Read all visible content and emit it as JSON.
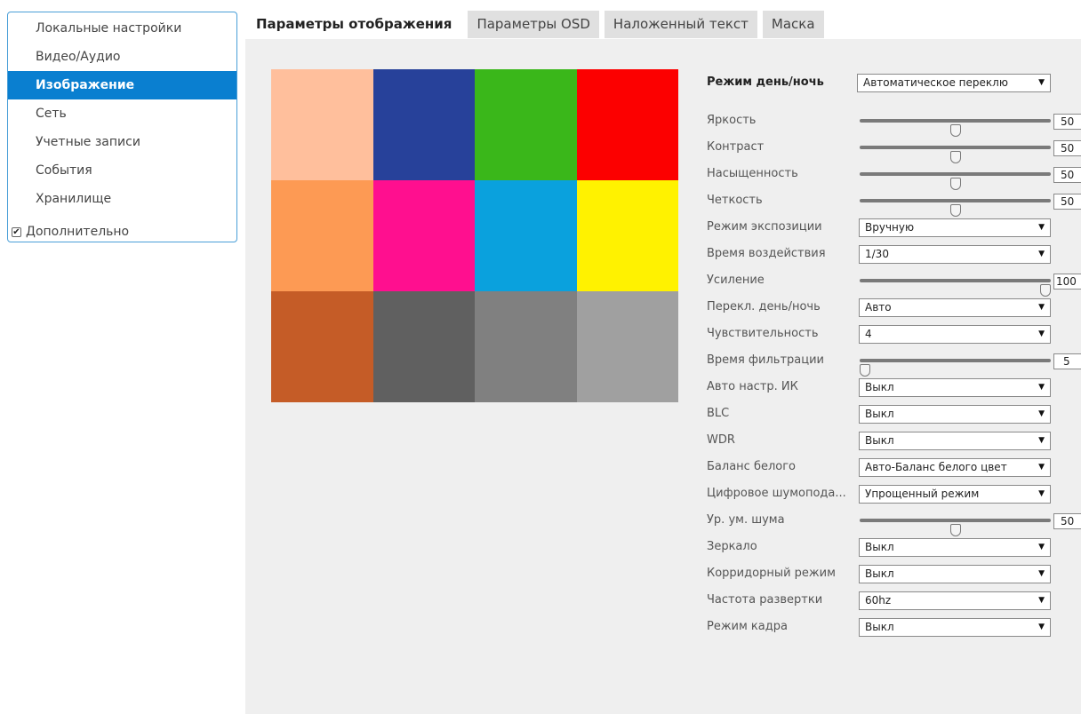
{
  "sidebar": {
    "items": [
      {
        "label": "Локальные настройки",
        "active": false
      },
      {
        "label": "Видео/Аудио",
        "active": false
      },
      {
        "label": "Изображение",
        "active": true
      },
      {
        "label": "Сеть",
        "active": false
      },
      {
        "label": "Учетные записи",
        "active": false
      },
      {
        "label": "События",
        "active": false
      },
      {
        "label": "Хранилище",
        "active": false
      }
    ],
    "advanced": {
      "label": "Дополнительно",
      "checked": true
    }
  },
  "tabs": [
    {
      "label": "Параметры отображения",
      "active": true
    },
    {
      "label": "Параметры OSD",
      "active": false
    },
    {
      "label": "Наложенный текст",
      "active": false
    },
    {
      "label": "Маска",
      "active": false
    }
  ],
  "preview": {
    "swatches": [
      "#ffbf9c",
      "#27419a",
      "#3ab71a",
      "#fc0000",
      "#fd9a54",
      "#ff0f8f",
      "#0aa1dd",
      "#fff200",
      "#c55c27",
      "#606060",
      "#808080",
      "#a0a0a0"
    ]
  },
  "settings": {
    "day_night_mode": {
      "label": "Режим день/ночь",
      "value": "Автоматическое переклю"
    },
    "brightness": {
      "label": "Яркость",
      "value": "50",
      "fraction": 0.5
    },
    "contrast": {
      "label": "Контраст",
      "value": "50",
      "fraction": 0.5
    },
    "saturation": {
      "label": "Насыщенность",
      "value": "50",
      "fraction": 0.5
    },
    "sharpness": {
      "label": "Четкость",
      "value": "50",
      "fraction": 0.5
    },
    "exposure_mode": {
      "label": "Режим экспозиции",
      "value": "Вручную"
    },
    "exposure_time": {
      "label": "Время воздействия",
      "value": "1/30"
    },
    "gain": {
      "label": "Усиление",
      "value": "100",
      "fraction": 1.0
    },
    "day_night_switch": {
      "label": "Перекл. день/ночь",
      "value": "Авто"
    },
    "sensitivity": {
      "label": "Чувствительность",
      "value": "4"
    },
    "filter_time": {
      "label": "Время фильтрации",
      "value": "5",
      "fraction": 0.0
    },
    "auto_ir": {
      "label": "Авто настр. ИК",
      "value": "Выкл"
    },
    "blc": {
      "label": "BLC",
      "value": "Выкл"
    },
    "wdr": {
      "label": "WDR",
      "value": "Выкл"
    },
    "white_balance": {
      "label": "Баланс белого",
      "value": "Авто-Баланс белого цвет"
    },
    "digital_nr": {
      "label": "Цифровое шумопода...",
      "value": "Упрощенный режим"
    },
    "nr_level": {
      "label": "Ур. ум. шума",
      "value": "50",
      "fraction": 0.5
    },
    "mirror": {
      "label": "Зеркало",
      "value": "Выкл"
    },
    "corridor_mode": {
      "label": "Корридорный режим",
      "value": "Выкл"
    },
    "scan_freq": {
      "label": "Частота развертки",
      "value": "60hz"
    },
    "frame_mode": {
      "label": "Режим кадра",
      "value": "Выкл"
    }
  }
}
